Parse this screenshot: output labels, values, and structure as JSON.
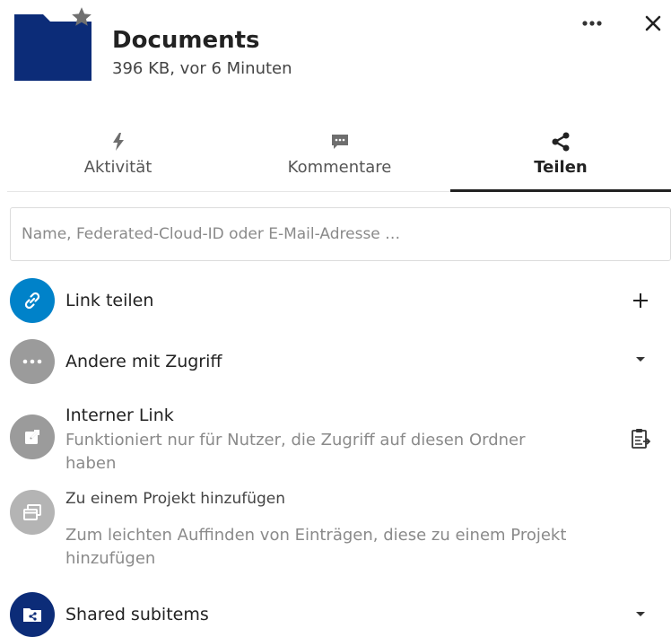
{
  "header": {
    "title": "Documents",
    "subtitle": "396 KB, vor 6 Minuten",
    "folder_color": "#0c2c78"
  },
  "tabs": [
    {
      "label": "Aktivität",
      "icon": "lightning-icon",
      "active": false
    },
    {
      "label": "Kommentare",
      "icon": "comment-icon",
      "active": false
    },
    {
      "label": "Teilen",
      "icon": "share-icon",
      "active": true
    }
  ],
  "search": {
    "placeholder": "Name, Federated-Cloud-ID oder E-Mail-Adresse …",
    "value": ""
  },
  "rows": {
    "share_link": {
      "title": "Link teilen",
      "icon": "link-icon",
      "action": "plus-icon"
    },
    "others_access": {
      "title": "Andere mit Zugriff",
      "icon": "dots-icon",
      "action": "caret-down-icon"
    },
    "internal_link": {
      "title": "Interner Link",
      "subtitle_line1": "Funktioniert nur für Nutzer, die Zugriff auf diesen Ordner",
      "subtitle_line2": "haben",
      "icon": "external-link-icon",
      "action": "clipboard-icon"
    },
    "project": {
      "title": "Zu einem Projekt hinzufügen",
      "subtitle_line1": "Zum leichten Auffinden von Einträgen, diese zu einem Projekt",
      "subtitle_line2": "hinzufügen",
      "icon": "project-icon"
    },
    "shared_subitems": {
      "title": "Shared subitems",
      "icon": "shared-folder-icon",
      "action": "caret-down-icon"
    }
  },
  "colors": {
    "accent_blue": "#0082c9",
    "grey_avatar": "#9b9b9b",
    "navy": "#0c2c78"
  }
}
